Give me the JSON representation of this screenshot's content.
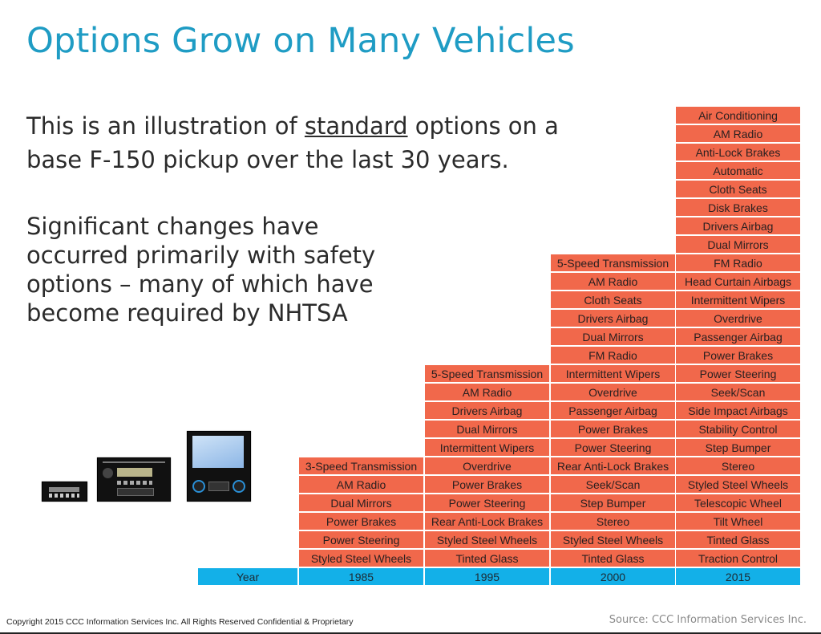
{
  "slide": {
    "title": "Options Grow on Many Vehicles",
    "intro": {
      "before": "This is an illustration of ",
      "emphasis": "standard",
      "after": " options on a base F-150 pickup over the last 30 years."
    },
    "paragraph": "Significant changes have occurred primarily with safety options – many of which have become required by NHTSA",
    "images": [
      "radio-1985-icon",
      "radio-cassette-icon",
      "touchscreen-infotainment-icon"
    ]
  },
  "table": {
    "row_header": "Year",
    "columns": [
      {
        "year": "1985",
        "options": [
          "3-Speed Transmission",
          "AM Radio",
          "Dual Mirrors",
          "Power Brakes",
          "Power Steering",
          "Styled Steel Wheels"
        ]
      },
      {
        "year": "1995",
        "options": [
          "5-Speed Transmission",
          "AM Radio",
          "Drivers Airbag",
          "Dual Mirrors",
          "Intermittent Wipers",
          "Overdrive",
          "Power Brakes",
          "Power Steering",
          "Rear Anti-Lock Brakes",
          "Styled Steel Wheels",
          "Tinted Glass"
        ]
      },
      {
        "year": "2000",
        "options": [
          "5-Speed Transmission",
          "AM Radio",
          "Cloth Seats",
          "Drivers Airbag",
          "Dual Mirrors",
          "FM Radio",
          "Intermittent Wipers",
          "Overdrive",
          "Passenger Airbag",
          "Power Brakes",
          "Power Steering",
          "Rear Anti-Lock Brakes",
          "Seek/Scan",
          "Step Bumper",
          "Stereo",
          "Styled Steel Wheels",
          "Tinted Glass"
        ]
      },
      {
        "year": "2015",
        "options": [
          "Air Conditioning",
          "AM Radio",
          "Anti-Lock Brakes",
          "Automatic",
          "Cloth Seats",
          "Disk Brakes",
          "Drivers Airbag",
          "Dual Mirrors",
          "FM Radio",
          "Head Curtain Airbags",
          "Intermittent Wipers",
          "Overdrive",
          "Passenger Airbag",
          "Power Brakes",
          "Power Steering",
          "Seek/Scan",
          "Side Impact Airbags",
          "Stability Control",
          "Step Bumper",
          "Stereo",
          "Styled Steel Wheels",
          "Telescopic Wheel",
          "Tilt Wheel",
          "Tinted Glass",
          "Traction Control"
        ]
      }
    ],
    "colors": {
      "option_fill": "#f1684b",
      "year_fill": "#13b0e8",
      "title": "#1f9cc4"
    }
  },
  "footer": {
    "copyright": "Copyright 2015 CCC Information Services Inc.  All Rights Reserved Confidential & Proprietary",
    "source": "Source: CCC Information Services Inc."
  }
}
